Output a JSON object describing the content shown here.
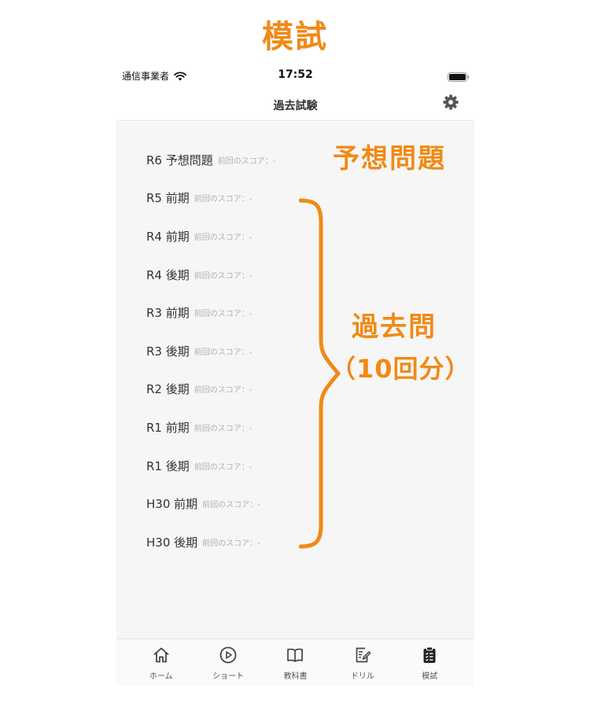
{
  "page_heading": "模試",
  "status_bar": {
    "carrier": "通信事業者",
    "time": "17:52"
  },
  "nav": {
    "title": "過去試験"
  },
  "exams": [
    {
      "name": "R6 予想問題",
      "score": "前回のスコア：-"
    },
    {
      "name": "R5 前期",
      "score": "前回のスコア：-"
    },
    {
      "name": "R4 前期",
      "score": "前回のスコア：-"
    },
    {
      "name": "R4 後期",
      "score": "前回のスコア：-"
    },
    {
      "name": "R3 前期",
      "score": "前回のスコア：-"
    },
    {
      "name": "R3 後期",
      "score": "前回のスコア：-"
    },
    {
      "name": "R2 後期",
      "score": "前回のスコア：-"
    },
    {
      "name": "R1 前期",
      "score": "前回のスコア：-"
    },
    {
      "name": "R1 後期",
      "score": "前回のスコア：-"
    },
    {
      "name": "H30 前期",
      "score": "前回のスコア：-"
    },
    {
      "name": "H30 後期",
      "score": "前回のスコア：-"
    }
  ],
  "tabs": [
    {
      "label": "ホーム",
      "icon": "home-icon"
    },
    {
      "label": "ショート",
      "icon": "play-circle-icon"
    },
    {
      "label": "教科書",
      "icon": "book-icon"
    },
    {
      "label": "ドリル",
      "icon": "edit-note-icon"
    },
    {
      "label": "模試",
      "icon": "clipboard-icon"
    }
  ],
  "annotations": {
    "yoso": "予想問題",
    "kakomon": "過去問",
    "count": "（10回分）"
  },
  "colors": {
    "accent": "#f08a16",
    "list_background": "#f6f6f6",
    "score_text": "#b0b0b0"
  }
}
